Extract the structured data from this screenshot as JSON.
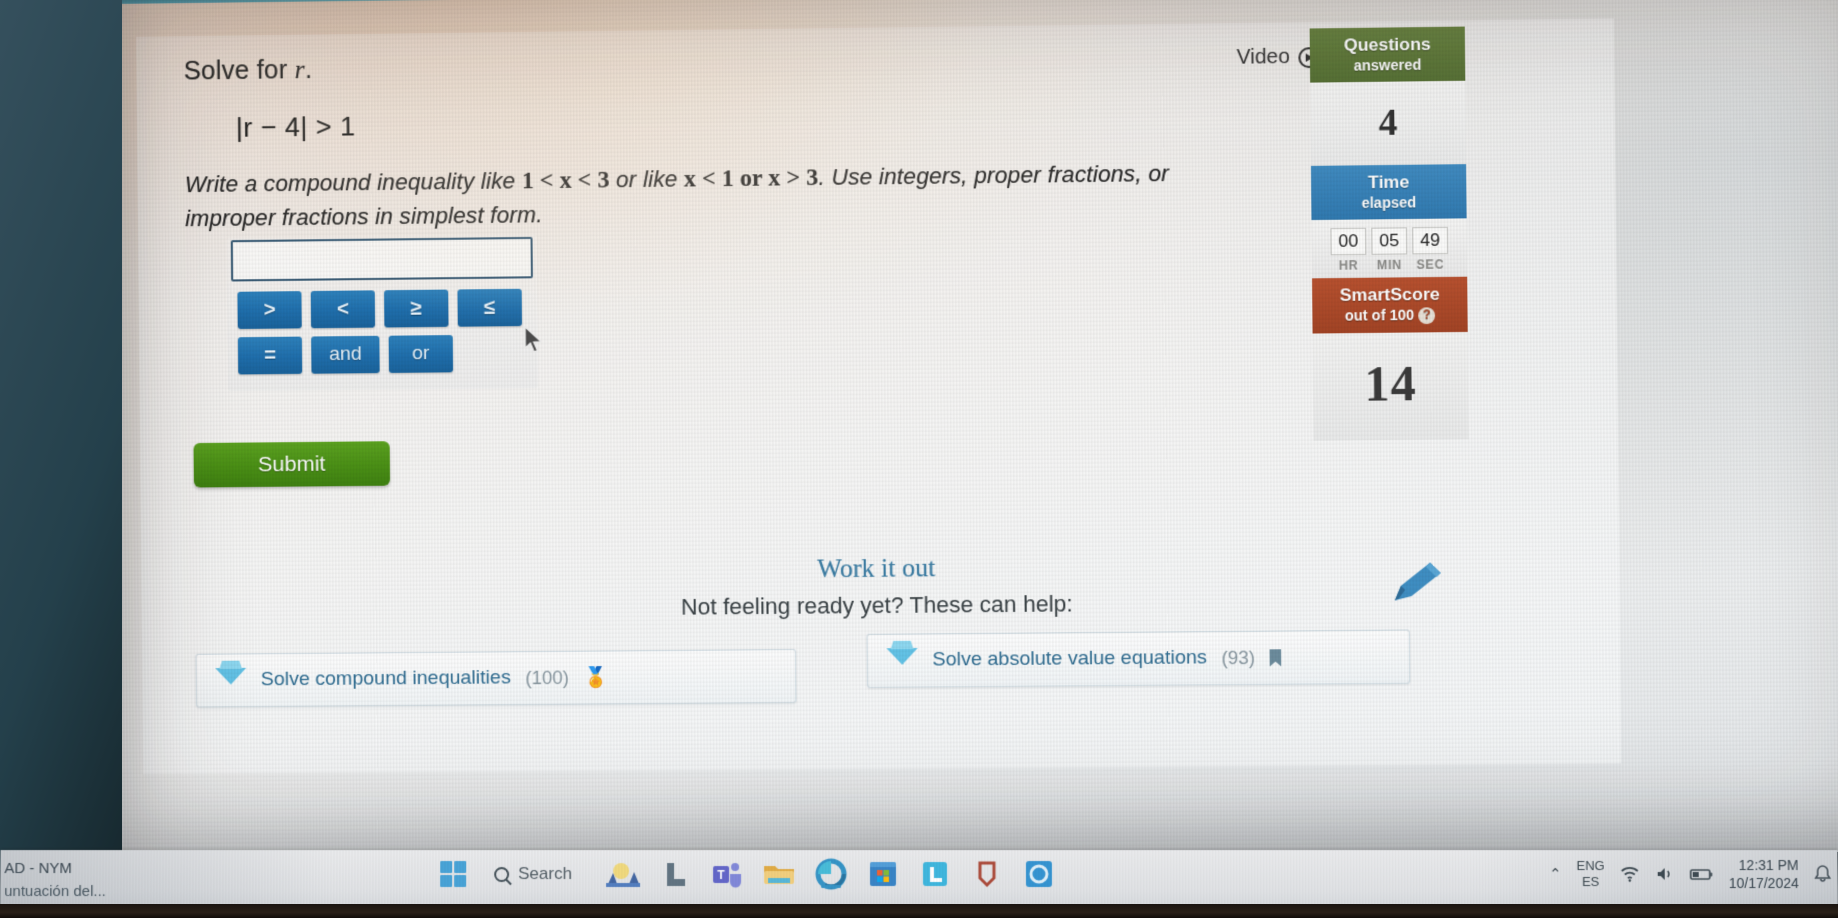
{
  "question": {
    "prompt_prefix": "Solve for ",
    "prompt_var": "r",
    "prompt_suffix": ".",
    "expression": "|r − 4| > 1",
    "expression_var": "r",
    "instruction_part1": "Write a compound inequality like ",
    "instruction_example1": "1 < x < 3",
    "instruction_part2": " or like ",
    "instruction_example2": "x < 1 or x > 3",
    "instruction_part3": ". Use integers, proper fractions, or improper fractions in simplest form."
  },
  "answer": {
    "value": "",
    "placeholder": ""
  },
  "keypad": {
    "row1": [
      ">",
      "<",
      "≥",
      "≤"
    ],
    "row2": [
      "=",
      "and",
      "or"
    ]
  },
  "actions": {
    "submit_label": "Submit",
    "video_label": "Video"
  },
  "sidebar": {
    "questions_title": "Questions",
    "questions_subtitle": "answered",
    "questions_value": "4",
    "time_title": "Time",
    "time_subtitle": "elapsed",
    "timer": {
      "hours": "00",
      "minutes": "05",
      "seconds": "49",
      "hours_label": "HR",
      "minutes_label": "MIN",
      "seconds_label": "SEC"
    },
    "smartscore_title": "SmartScore",
    "smartscore_subtitle": "out of 100",
    "smartscore_help": "?",
    "smartscore_value": "14"
  },
  "work_it_out": {
    "title": "Work it out",
    "subtitle": "Not feeling ready yet? These can help:",
    "cards": [
      {
        "label": "Solve compound inequalities",
        "count": "(100)",
        "badge": "🏅"
      },
      {
        "label": "Solve absolute value equations",
        "count": "(93)",
        "badge": "bookmark"
      }
    ]
  },
  "taskbar": {
    "left_line1": "AD - NYM",
    "left_line2": "untuación del...",
    "search_placeholder": "Search",
    "apps": [
      "weather-widget",
      "copilot",
      "teams",
      "file-explorer",
      "edge",
      "microsoft-store",
      "linkedin",
      "shield",
      "circle-app"
    ],
    "tray": {
      "chevron": "⌃",
      "lang_line1": "ENG",
      "lang_line2": "ES",
      "time": "12:31 PM",
      "date": "10/17/2024"
    }
  },
  "colors": {
    "accent_blue": "#1f6fad",
    "submit_green": "#4c9216",
    "questions_green": "#4f6a2b",
    "time_blue": "#2f79b0",
    "smartscore_red": "#a34425",
    "link_blue": "#2f6d92"
  }
}
